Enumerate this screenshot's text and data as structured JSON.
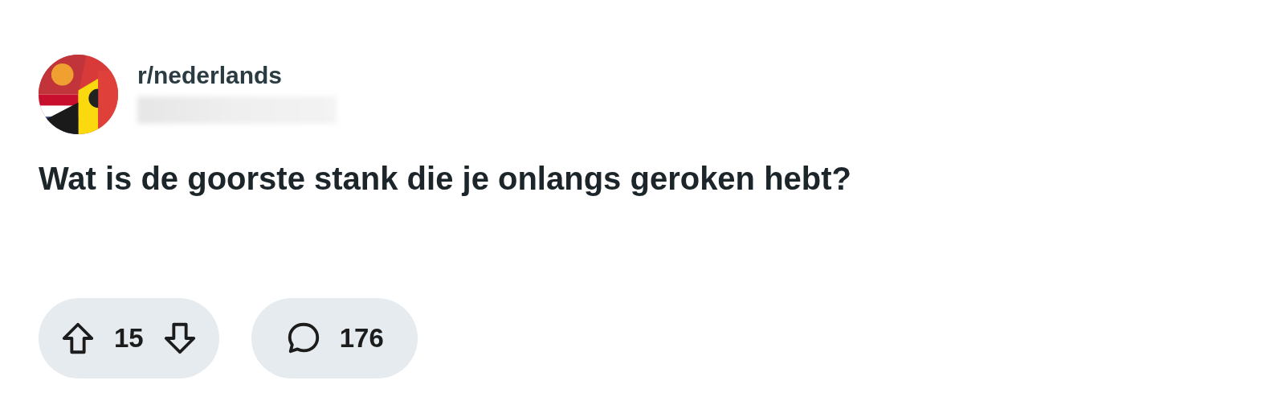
{
  "post": {
    "subreddit": "r/nederlands",
    "title": "Wat is de goorste stank die je onlangs geroken hebt?",
    "votes": "15",
    "comments": "176"
  }
}
